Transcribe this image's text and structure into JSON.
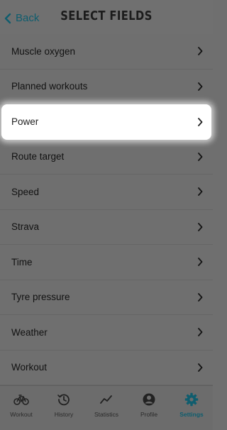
{
  "header": {
    "back_label": "Back",
    "title": "SELECT FIELDS"
  },
  "fields": [
    {
      "label": "Muscle oxygen"
    },
    {
      "label": "Planned workouts"
    },
    {
      "label": "Power"
    },
    {
      "label": "Route target"
    },
    {
      "label": "Speed"
    },
    {
      "label": "Strava"
    },
    {
      "label": "Time"
    },
    {
      "label": "Tyre pressure"
    },
    {
      "label": "Weather"
    },
    {
      "label": "Workout"
    }
  ],
  "highlighted_field": "Power",
  "tabs": [
    {
      "label": "Workout",
      "icon": "bicycle-icon"
    },
    {
      "label": "History",
      "icon": "history-icon"
    },
    {
      "label": "Statistics",
      "icon": "statistics-icon"
    },
    {
      "label": "Profile",
      "icon": "profile-icon"
    },
    {
      "label": "Settings",
      "icon": "gear-icon"
    }
  ],
  "active_tab": "Settings",
  "colors": {
    "accent": "#0f5d6e",
    "overlay_background": "#6f6f6f",
    "highlight_background": "#ffffff"
  }
}
